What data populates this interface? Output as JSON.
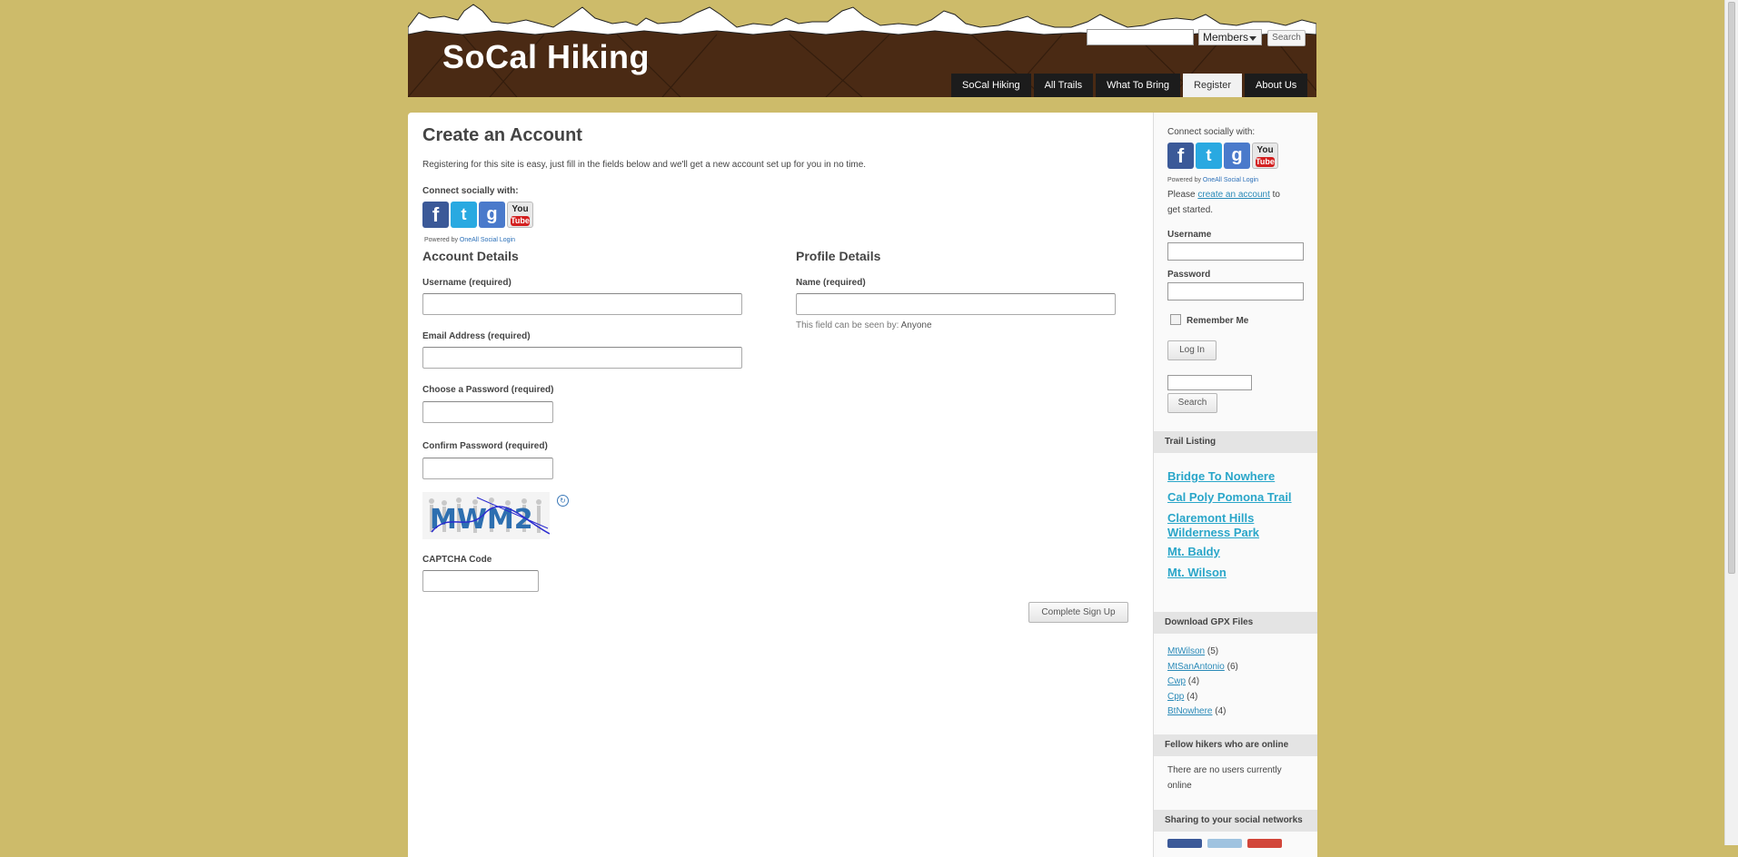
{
  "site": {
    "title": "SoCal Hiking"
  },
  "header_search": {
    "scope": "Members",
    "button": "Search"
  },
  "nav": [
    {
      "label": "SoCal Hiking",
      "active": false
    },
    {
      "label": "All Trails",
      "active": false
    },
    {
      "label": "What To Bring",
      "active": false
    },
    {
      "label": "Register",
      "active": true
    },
    {
      "label": "About Us",
      "active": false
    }
  ],
  "page": {
    "title": "Create an Account",
    "intro": "Registering for this site is easy, just fill in the fields below and we'll get a new account set up for you in no time.",
    "connect_label": "Connect socially with:",
    "powered_by": "Powered by",
    "powered_link": "OneAll Social Login",
    "account_details": "Account Details",
    "profile_details": "Profile Details",
    "username_label": "Username (required)",
    "email_label": "Email Address (required)",
    "password_label": "Choose a Password (required)",
    "confirm_label": "Confirm Password (required)",
    "name_label": "Name (required)",
    "visibility_prefix": "This field can be seen by:",
    "visibility_value": "Anyone",
    "captcha_text": "MWM2",
    "captcha_label": "CAPTCHA Code",
    "submit": "Complete Sign Up"
  },
  "social_icons": [
    {
      "name": "facebook-icon",
      "glyph": "f"
    },
    {
      "name": "twitter-icon",
      "glyph": "t"
    },
    {
      "name": "google-icon",
      "glyph": "g"
    },
    {
      "name": "youtube-icon",
      "glyph": "You",
      "sub": "Tube"
    }
  ],
  "sidebar": {
    "connect_label": "Connect socially with:",
    "powered_by": "Powered by",
    "powered_link": "OneAll Social Login",
    "please": "Please",
    "create_link": "create an account",
    "to_start": "to get started.",
    "username": "Username",
    "password": "Password",
    "remember": "Remember Me",
    "login": "Log In",
    "search": "Search",
    "trail_heading": "Trail Listing",
    "trails": [
      "Bridge To Nowhere",
      "Cal Poly Pomona Trail",
      "Claremont Hills Wilderness Park",
      "Mt. Baldy",
      "Mt. Wilson"
    ],
    "gpx_heading": "Download GPX Files",
    "gpx": [
      {
        "name": "MtWilson",
        "count": "(5)"
      },
      {
        "name": "MtSanAntonio",
        "count": "(6)"
      },
      {
        "name": "Cwp",
        "count": "(4)"
      },
      {
        "name": "Cpp",
        "count": "(4)"
      },
      {
        "name": "BtNowhere",
        "count": "(4)"
      }
    ],
    "online_heading": "Fellow hikers who are online",
    "online_text": "There are no users currently online",
    "share_heading": "Sharing to your social networks"
  }
}
